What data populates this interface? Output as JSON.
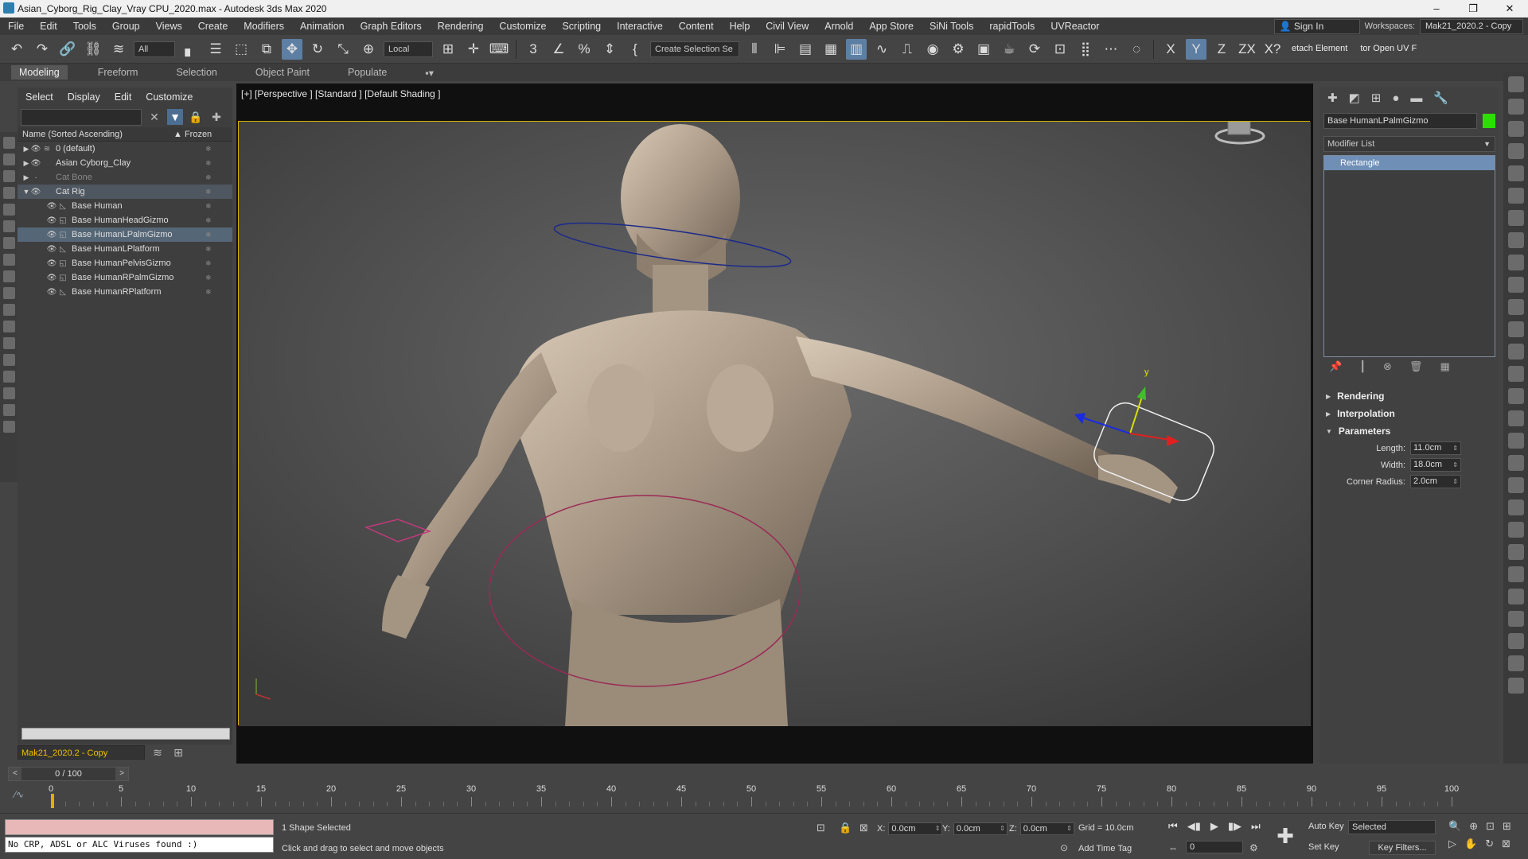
{
  "window": {
    "title": "Asian_Cyborg_Rig_Clay_Vray CPU_2020.max - Autodesk 3ds Max 2020",
    "controls": [
      "–",
      "❐",
      "✕"
    ]
  },
  "menubar": {
    "items": [
      "File",
      "Edit",
      "Tools",
      "Group",
      "Views",
      "Create",
      "Modifiers",
      "Animation",
      "Graph Editors",
      "Rendering",
      "Customize",
      "Scripting",
      "Interactive",
      "Content",
      "Help",
      "Civil View",
      "Arnold",
      "App Store",
      "SiNi Tools",
      "rapidTools",
      "UVReactor"
    ],
    "sign_in": "Sign In",
    "workspaces_label": "Workspaces:",
    "workspace_value": "Mak21_2020.2 - Copy"
  },
  "toolbar": {
    "selection_filter": "All",
    "ref_coord": "Local",
    "named_selection": "Create Selection Se",
    "axis_x": "X",
    "axis_y": "Y",
    "axis_z": "Z",
    "axis_zx": "ZX",
    "axis_xy": "X?",
    "detach": "etach Element",
    "open_uv": "tor Open UV F"
  },
  "ribbon": {
    "tabs": [
      "Modeling",
      "Freeform",
      "Selection",
      "Object Paint",
      "Populate"
    ]
  },
  "scene_explorer": {
    "menu": [
      "Select",
      "Display",
      "Edit",
      "Customize"
    ],
    "col_name": "Name (Sorted Ascending)",
    "col_frozen": "▲ Frozen",
    "rows": [
      {
        "label": "0 (default)"
      },
      {
        "label": "Asian Cyborg_Clay"
      },
      {
        "label": "Cat Bone"
      },
      {
        "label": "Cat Rig"
      },
      {
        "label": "Base Human"
      },
      {
        "label": "Base HumanHeadGizmo"
      },
      {
        "label": "Base HumanLPalmGizmo"
      },
      {
        "label": "Base HumanLPlatform"
      },
      {
        "label": "Base HumanPelvisGizmo"
      },
      {
        "label": "Base HumanRPalmGizmo"
      },
      {
        "label": "Base HumanRPlatform"
      }
    ],
    "layer": "Mak21_2020.2 - Copy"
  },
  "viewport": {
    "label": "[+] [Perspective ] [Standard ] [Default Shading ]",
    "gizmo_y": "y"
  },
  "command_panel": {
    "object_name": "Base HumanLPalmGizmo",
    "object_color": "#2be000",
    "modifier_list": "Modifier List",
    "stack_item": "Rectangle",
    "rollouts": {
      "rendering": "Rendering",
      "interpolation": "Interpolation",
      "parameters": "Parameters"
    },
    "params": [
      {
        "label": "Length:",
        "value": "11.0cm"
      },
      {
        "label": "Width:",
        "value": "18.0cm"
      },
      {
        "label": "Corner Radius:",
        "value": "2.0cm"
      }
    ]
  },
  "timeline": {
    "frame": "0 / 100",
    "ticks": [
      "0",
      "5",
      "10",
      "15",
      "20",
      "25",
      "30",
      "35",
      "40",
      "45",
      "50",
      "55",
      "60",
      "65",
      "70",
      "75",
      "80",
      "85",
      "90",
      "95",
      "100"
    ]
  },
  "status": {
    "maxscript_output": "No CRP, ADSL or ALC Viruses found :)",
    "selection": "1 Shape Selected",
    "prompt": "Click and drag to select and move objects",
    "x_label": "X:",
    "x_value": "0.0cm",
    "y_label": "Y:",
    "y_value": "0.0cm",
    "z_label": "Z:",
    "z_value": "0.0cm",
    "grid": "Grid = 10.0cm",
    "add_time_tag": "Add Time Tag",
    "current_frame": "0",
    "auto_key": "Auto Key",
    "set_key": "Set Key",
    "key_mode": "Selected",
    "key_filters": "Key Filters..."
  }
}
